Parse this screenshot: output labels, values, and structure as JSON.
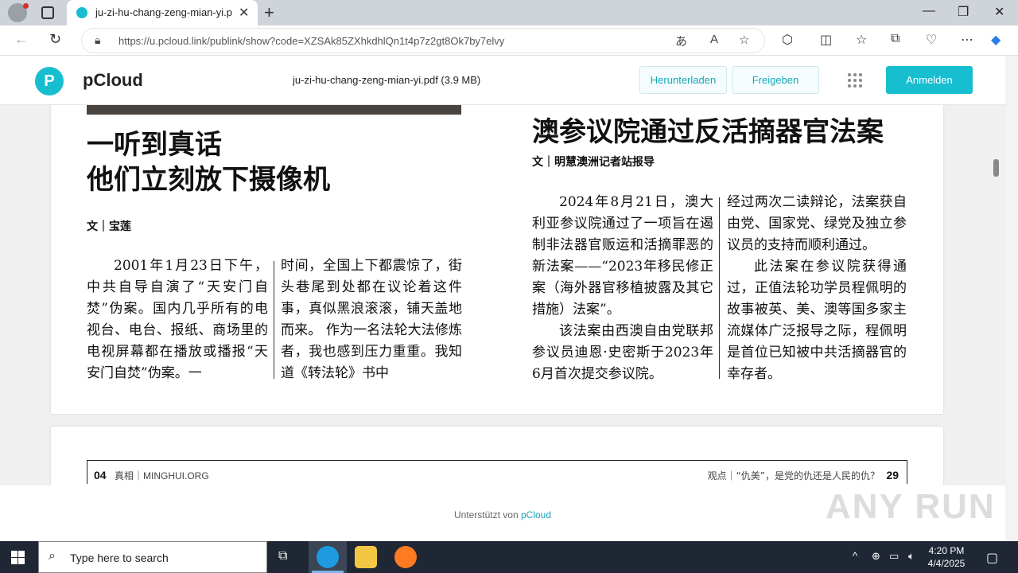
{
  "browser": {
    "tab_title": "ju-zi-hu-chang-zeng-mian-yi.pdf",
    "url": "https://u.pcloud.link/publink/show?code=XZSAk85ZXhkdhlQn1t4p7z2gt8Ok7by7elvy"
  },
  "pcloud": {
    "logo": "pCloud",
    "file_name": "ju-zi-hu-chang-zeng-mian-yi.pdf (3.9 MB)",
    "download_label": "Herunterladen",
    "share_label": "Freigeben",
    "login_label": "Anmelden",
    "supported_prefix": "Unterstützt von ",
    "supported_brand": "pCloud",
    "brand_color": "#17bed0"
  },
  "pdf": {
    "left_article": {
      "title_line1": "一听到真话",
      "title_line2": "他们立刻放下摄像机",
      "byline": "文｜宝莲",
      "col1": "2001年1月23日下午，中共自导自演了“天安门自焚”伪案。国内几乎所有的电视台、电台、报纸、商场里的电视屏幕都在播放或播报“天安门自焚”伪案。一",
      "col2": "时间，全国上下都震惊了，街头巷尾到处都在议论着这件事，真似黑浪滚滚，铺天盖地而来。 作为一名法轮大法修炼者，我也感到压力重重。我知道《转法轮》书中"
    },
    "right_article": {
      "title": "澳参议院通过反活摘器官法案",
      "byline": "文｜明慧澳洲记者站报导",
      "col1_p1": "2024年8月21日，澳大利亚参议院通过了一项旨在遏制非法器官贩运和活摘罪恶的新法案——“2023年移民修正案（海外器官移植披露及其它措施）法案”。",
      "col1_p2": "该法案由西澳自由党联邦参议员迪恩·史密斯于2023年6月首次提交参议院。",
      "col2_p1": "经过两次二读辩论，法案获自由党、国家党、绿党及独立参议员的支持而顺利通过。",
      "col2_p2": "此法案在参议院获得通过，正值法轮功学员程佩明的故事被英、美、澳等国多家主流媒体广泛报导之际，程佩明是首位已知被中共活摘器官的幸存者。"
    },
    "footer": {
      "left_page": "04",
      "left_source": "真相｜MINGHUI.ORG",
      "right_text": "观点｜“仇美”，是党的仇还是人民的仇？",
      "right_page": "29"
    }
  },
  "taskbar": {
    "search_placeholder": "Type here to search",
    "time": "4:20 PM",
    "date": "4/4/2025"
  },
  "watermark": "ANY RUN"
}
